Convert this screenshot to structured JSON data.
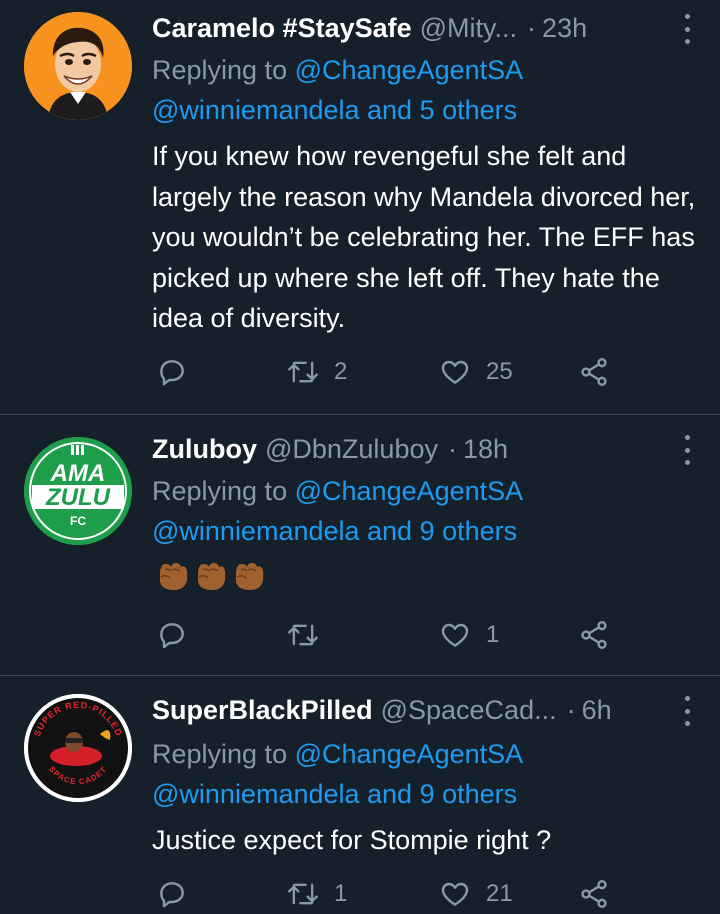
{
  "tweets": [
    {
      "name": "Caramelo #StaySafe",
      "handle": "@Mity...",
      "time": "23h",
      "replying_prefix": "Replying to",
      "replying_to": "@ChangeAgentSA",
      "mentions": "@winniemandela and 5 others",
      "text": "If you knew how revengeful she felt and largely the reason why Mandela divorced her, you wouldn’t be celebrating her. The EFF has picked up where she left off. They hate the idea of diversity.",
      "retweets": "2",
      "likes": "25"
    },
    {
      "name": "Zuluboy",
      "handle": "@DbnZuluboy",
      "time": "18h",
      "replying_prefix": "Replying to",
      "replying_to": "@ChangeAgentSA",
      "mentions": "@winniemandela and 9 others",
      "emoji": "✊🏾✊🏾✊🏾",
      "retweets": "",
      "likes": "1",
      "avatar_text": {
        "line1": "AMA",
        "line2": "ZULU",
        "line3": "FC"
      }
    },
    {
      "name": "SuperBlackPilled",
      "handle": "@SpaceCad...",
      "time": "6h",
      "replying_prefix": "Replying to",
      "replying_to": "@ChangeAgentSA",
      "mentions": "@winniemandela and 9 others",
      "text": "Justice expect for Stompie right ?",
      "retweets": "1",
      "likes": "21",
      "avatar_text": {
        "top": "SUPER RED-PILLED",
        "bottom": "SPACE CADET"
      }
    }
  ],
  "icons": {
    "reply": "reply-icon",
    "retweet": "retweet-icon",
    "like": "like-icon",
    "share": "share-icon",
    "more": "more-icon"
  },
  "colors": {
    "background": "#15202b",
    "secondary_text": "#8b98a5",
    "link": "#1d9bf0",
    "divider": "#38444d"
  }
}
